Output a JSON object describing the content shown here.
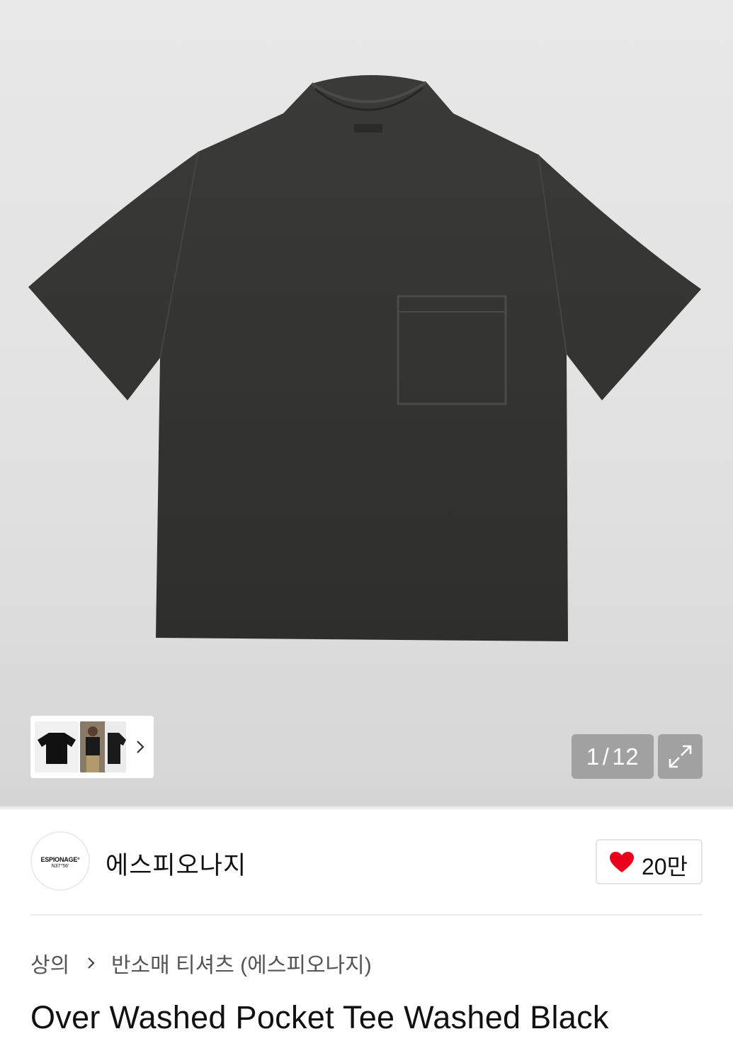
{
  "gallery": {
    "current_page": "1",
    "separator": "/",
    "total_pages": "12",
    "expand_icon": "expand-arrows-icon",
    "thumbnail_next_icon": "chevron-right-icon"
  },
  "brand": {
    "logo_text": "ESPIONAGE°",
    "logo_subtext": "N37°56'",
    "name": "에스피오나지"
  },
  "like": {
    "icon": "heart-icon",
    "count": "20만",
    "color": "#e8001c"
  },
  "breadcrumb": {
    "category": "상의",
    "subcategory": "반소매 티셔츠 (에스피오나지)"
  },
  "product": {
    "title": "Over Washed Pocket Tee Washed Black"
  }
}
